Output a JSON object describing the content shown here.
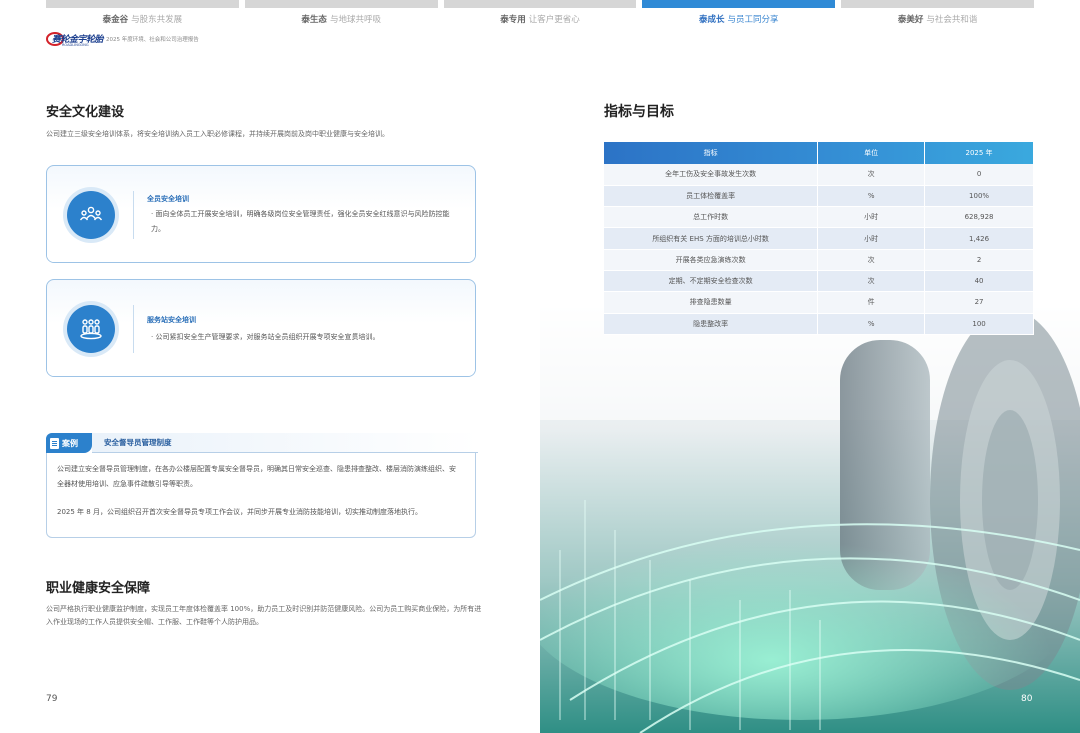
{
  "nav": {
    "tabs": [
      {
        "main": "泰金谷",
        "sub": "与股东共发展",
        "active": false
      },
      {
        "main": "泰生态",
        "sub": "与地球共呼吸",
        "active": false
      },
      {
        "main": "泰专用",
        "sub": "让客户更省心",
        "active": false
      },
      {
        "main": "泰成长",
        "sub": "与员工同分享",
        "active": true
      },
      {
        "main": "泰美好",
        "sub": "与社会共和谐",
        "active": false
      }
    ]
  },
  "logo": {
    "text": "赛轮金宇轮胎",
    "sub": "ROADLINGONG",
    "tagline": "2025 年度环境、社会和公司治理报告"
  },
  "left": {
    "section1": {
      "title": "安全文化建设",
      "intro": "公司建立三级安全培训体系，将安全培训纳入员工入职必修课程，并持续开展岗前及岗中职业健康与安全培训。",
      "cards": [
        {
          "icon": "group-people-icon",
          "title": "全员安全培训",
          "body": "· 面向全体员工开展安全培训，明确各级岗位安全管理责任，强化全员安全红线意识与风险防控能力。"
        },
        {
          "icon": "people-podium-icon",
          "title": "服务站安全培训",
          "body": "· 公司紧扣安全生产管理要求，对服务站全员组织开展专项安全宣贯培训。"
        }
      ]
    },
    "case": {
      "badge": "案例",
      "title": "安全督导员管理制度",
      "paragraphs": [
        "公司建立安全督导员管理制度，在各办公楼层配置专属安全督导员，明确其日常安全巡查、隐患排查整改、楼层消防演练组织、安全器材使用培训、应急事件疏散引导等职责。",
        "2025 年 8 月，公司组织召开首次安全督导员专项工作会议，并同步开展专业消防技能培训，切实推动制度落地执行。"
      ]
    },
    "section2": {
      "title": "职业健康安全保障",
      "body": "公司严格执行职业健康监护制度，实现员工年度体检覆盖率 100%，助力员工及时识别并防范健康风险。公司为员工购买商业保险，为所有进入作业现场的工作人员提供安全帽、工作服、工作鞋等个人防护用品。"
    },
    "page_number": "79"
  },
  "right": {
    "title": "指标与目标",
    "table": {
      "headers": [
        "指标",
        "单位",
        "2025 年"
      ],
      "rows": [
        [
          "全年工伤及安全事故发生次数",
          "次",
          "0"
        ],
        [
          "员工体检覆盖率",
          "%",
          "100%"
        ],
        [
          "总工作时数",
          "小时",
          "628,928"
        ],
        [
          "所组织有关 EHS 方面的培训总小时数",
          "小时",
          "1,426"
        ],
        [
          "开展各类应急演练次数",
          "次",
          "2"
        ],
        [
          "定期、不定期安全检查次数",
          "次",
          "40"
        ],
        [
          "排查隐患数量",
          "件",
          "27"
        ],
        [
          "隐患整改率",
          "%",
          "100"
        ]
      ]
    },
    "page_number": "80"
  }
}
